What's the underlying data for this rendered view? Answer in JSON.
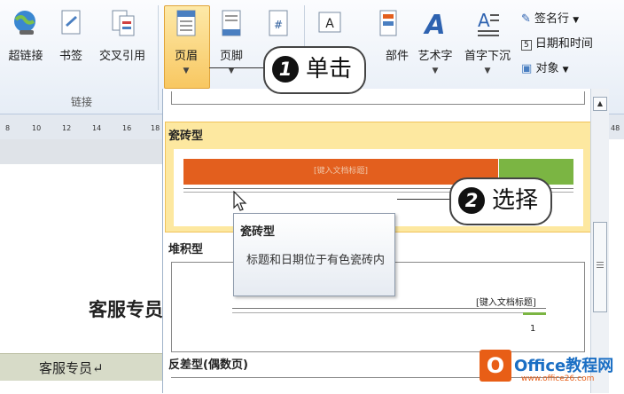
{
  "ribbon": {
    "buttons": [
      {
        "label": "超链接",
        "icon": "globe-link-icon"
      },
      {
        "label": "书签",
        "icon": "bookmark-icon"
      },
      {
        "label": "交叉引用",
        "icon": "cross-reference-icon"
      },
      {
        "label": "页眉",
        "icon": "header-icon",
        "pressed": true
      },
      {
        "label": "页脚",
        "icon": "footer-icon"
      },
      {
        "label": "部件",
        "icon": "quick-parts-icon"
      },
      {
        "label": "艺术字",
        "icon": "wordart-icon"
      },
      {
        "label": "首字下沉",
        "icon": "drop-cap-icon"
      }
    ],
    "small_buttons": [
      "签名行",
      "日期和时间",
      "对象"
    ],
    "group_label": "链接"
  },
  "ruler": {
    "ticks": [
      "8",
      "10",
      "12",
      "14",
      "16",
      "18"
    ],
    "right_tick": "48"
  },
  "document": {
    "heading": "客服专员",
    "footer": "客服专员↵"
  },
  "gallery": {
    "sections": {
      "tile": "瓷砖型",
      "stacked": "堆积型",
      "contrast": "反差型(偶数页)"
    },
    "tile_placeholder": "[键入文档标题]",
    "stacked_placeholder": "[键入文档标题]",
    "stacked_page_number": "1"
  },
  "tooltip": {
    "title": "瓷砖型",
    "description": "标题和日期位于有色瓷砖内"
  },
  "callouts": [
    {
      "number": "1",
      "text": "单击"
    },
    {
      "number": "2",
      "text": "选择"
    }
  ],
  "watermark": {
    "brand": "Office教程网",
    "url": "www.office26.com",
    "logo_letter": "O"
  },
  "colors": {
    "tile_orange": "#e35f1e",
    "tile_green": "#7bb543",
    "selection": "#fde8a0",
    "brand_blue": "#1b6fc4"
  }
}
